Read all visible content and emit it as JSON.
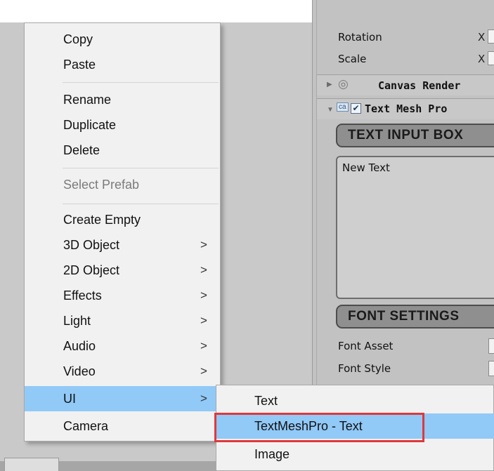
{
  "context_menu": {
    "items": [
      {
        "label": "Copy"
      },
      {
        "label": "Paste"
      },
      {
        "label": "Rename"
      },
      {
        "label": "Duplicate"
      },
      {
        "label": "Delete"
      },
      {
        "label": "Select Prefab",
        "disabled": true
      },
      {
        "label": "Create Empty"
      },
      {
        "label": "3D Object",
        "submenu_arrow": ">"
      },
      {
        "label": "2D Object",
        "submenu_arrow": ">"
      },
      {
        "label": "Effects",
        "submenu_arrow": ">"
      },
      {
        "label": "Light",
        "submenu_arrow": ">"
      },
      {
        "label": "Audio",
        "submenu_arrow": ">"
      },
      {
        "label": "Video",
        "submenu_arrow": ">"
      },
      {
        "label": "UI",
        "submenu_arrow": ">",
        "selected": true
      },
      {
        "label": "Camera"
      }
    ]
  },
  "ui_submenu": {
    "items": [
      {
        "label": "Text"
      },
      {
        "label": "TextMeshPro - Text",
        "selected": true,
        "highlighted": true
      },
      {
        "label": "Image"
      }
    ]
  },
  "inspector": {
    "rotation": {
      "label": "Rotation",
      "axis": "X"
    },
    "scale": {
      "label": "Scale",
      "axis": "X"
    },
    "canvas_renderer": {
      "title": "Canvas Render"
    },
    "text_mesh_pro": {
      "title": "Text Mesh Pro",
      "enabled": true,
      "icon_text": "ca"
    },
    "text_input_section": "TEXT INPUT BOX",
    "text_value": "New Text",
    "font_settings_section": "FONT SETTINGS",
    "font_asset_label": "Font Asset",
    "font_style_label": "Font Style",
    "foldout_collapsed": "▶",
    "foldout_expanded": "▼",
    "checkmark": "✔"
  },
  "colors": {
    "selection": "#91c9f7",
    "highlight_border": "#e0383b",
    "menu_bg": "#f1f1f1"
  }
}
